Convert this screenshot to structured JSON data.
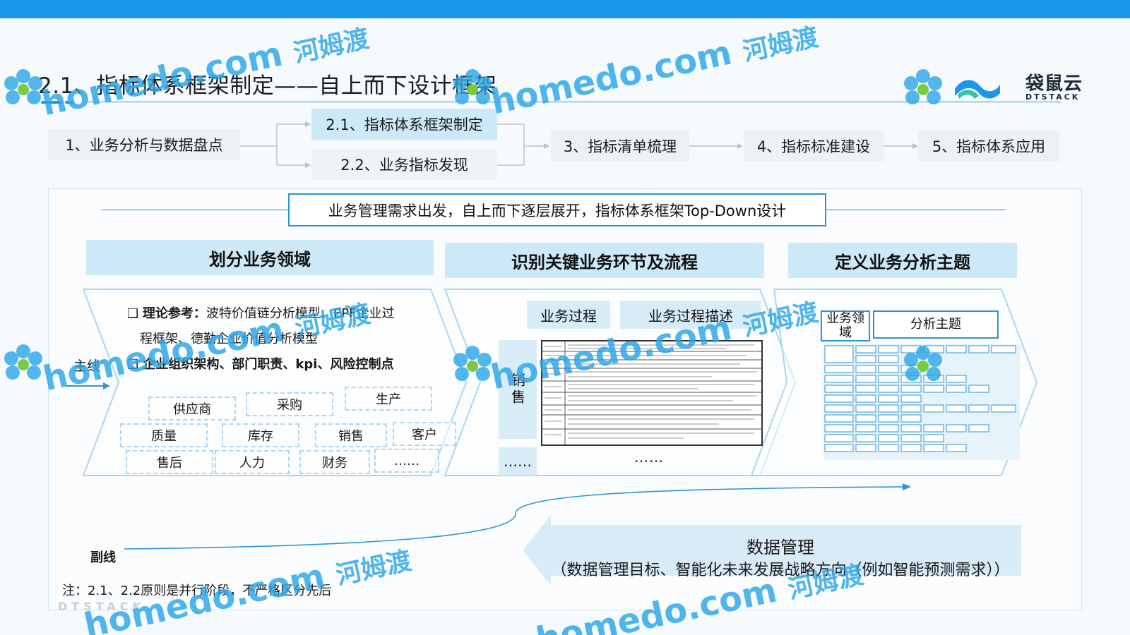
{
  "page": {
    "title": "2.1、指标体系框架制定——自上而下设计框架",
    "logo_text": "袋鼠云",
    "logo_sub": "DTSTACK"
  },
  "steps": {
    "step1": "1、业务分析与数据盘点",
    "step21": "2.1、指标体系框架制定",
    "step22": "2.2、业务指标发现",
    "step3": "3、指标清单梳理",
    "step4": "4、指标标准建设",
    "step5": "5、指标体系应用"
  },
  "banner": "业务管理需求出发，自上而下逐层展开，指标体系框架Top-Down设计",
  "sections": {
    "s1": "划分业务领域",
    "s2": "识别关键业务环节及流程",
    "s3": "定义业务分析主题"
  },
  "domain_section": {
    "theory_label": "理论参考：",
    "theory_text_1": "波特价值链分析模型、EPF企业过",
    "theory_text_2": "程框架、德勤企业价值分析模型",
    "org_text": "企业组织架构、部门职责、kpi、风险控制点",
    "domains": [
      "供应商",
      "采购",
      "生产",
      "质量",
      "库存",
      "销售",
      "客户",
      "售后",
      "人力",
      "财务",
      "……"
    ]
  },
  "process_section": {
    "tab1": "业务过程",
    "tab2": "业务过程描述",
    "sales_label": "销售",
    "more_left": "……",
    "more_right": "……"
  },
  "subject_section": {
    "col1": "业务领域",
    "col2": "分析主题"
  },
  "labels": {
    "main_line": "主线",
    "sub_line": "副线"
  },
  "data_mgmt": {
    "title": "数据管理",
    "desc": "（数据管理目标、智能化未来发展战略方向（例如智能预测需求））"
  },
  "note": "注：2.1、2.2原则是并行阶段，不严格区分先后",
  "footer_brand": "DTSTACK",
  "watermark": {
    "text": "homedo.com",
    "cn": "河姆渡"
  },
  "colors": {
    "accent": "#1a97e8",
    "header_fill": "#cde9f8",
    "watermark": "#2aa6e8"
  }
}
